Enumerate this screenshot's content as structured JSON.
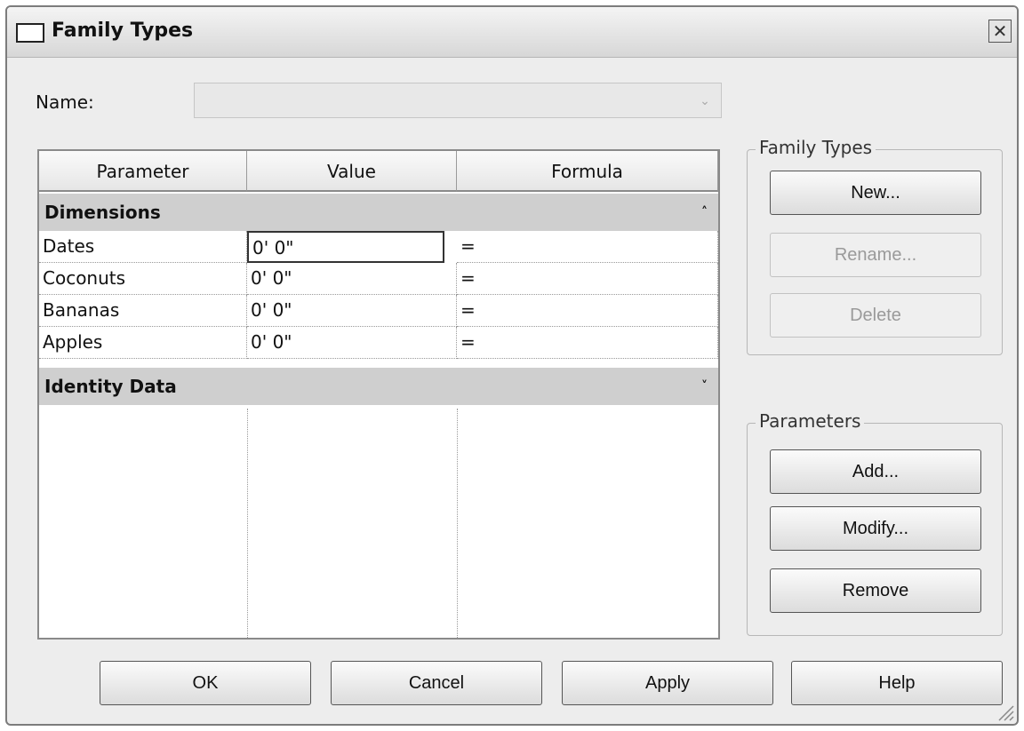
{
  "window": {
    "title": "Family Types",
    "close_label": "✕"
  },
  "name_field": {
    "label": "Name:",
    "value": ""
  },
  "grid": {
    "columns": [
      "Parameter",
      "Value",
      "Formula"
    ],
    "groups": [
      {
        "name": "Dimensions",
        "expanded": true,
        "rows": [
          {
            "parameter": "Dates",
            "value": "0'  0\"",
            "formula": "="
          },
          {
            "parameter": "Coconuts",
            "value": "0'  0\"",
            "formula": "="
          },
          {
            "parameter": "Bananas",
            "value": "0'  0\"",
            "formula": "="
          },
          {
            "parameter": "Apples",
            "value": "0'  0\"",
            "formula": "="
          }
        ]
      },
      {
        "name": "Identity Data",
        "expanded": false,
        "rows": []
      }
    ]
  },
  "family_types_box": {
    "title": "Family Types",
    "buttons": [
      {
        "label": "New...",
        "enabled": true
      },
      {
        "label": "Rename...",
        "enabled": false
      },
      {
        "label": "Delete",
        "enabled": false
      }
    ]
  },
  "parameters_box": {
    "title": "Parameters",
    "buttons": [
      {
        "label": "Add...",
        "enabled": true
      },
      {
        "label": "Modify...",
        "enabled": true
      },
      {
        "label": "Remove",
        "enabled": true
      }
    ]
  },
  "footer": {
    "buttons": [
      {
        "label": "OK"
      },
      {
        "label": "Cancel"
      },
      {
        "label": "Apply"
      },
      {
        "label": "Help"
      }
    ]
  }
}
